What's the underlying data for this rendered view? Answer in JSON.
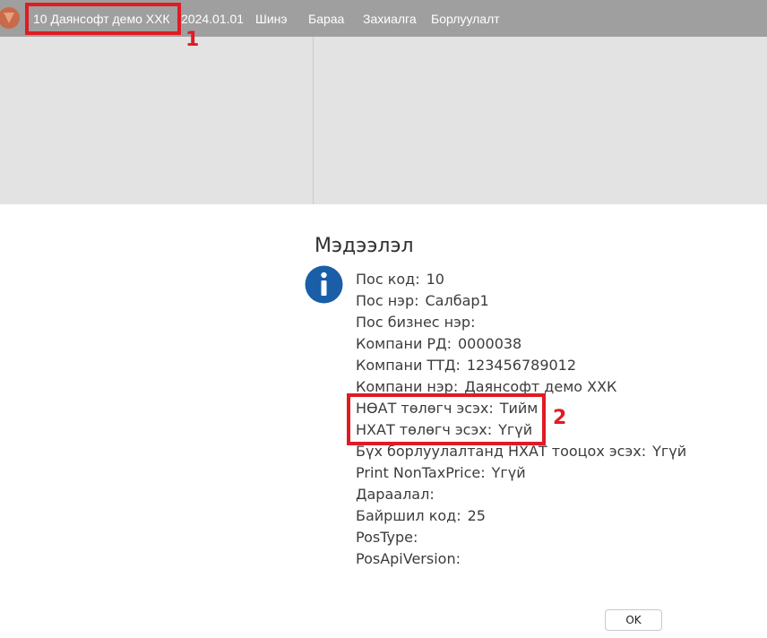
{
  "topbar": {
    "logo_icon": "app-logo-icon",
    "company": "10 Даянсофт демо ХХК",
    "date": "2024.01.01",
    "menu": [
      "Шинэ",
      "Бараа",
      "Захиалга",
      "Борлуулалт"
    ]
  },
  "annotations": {
    "marker_1": "1",
    "marker_2": "2",
    "color": "#e01b24"
  },
  "dialog": {
    "title": "Мэдээлэл",
    "icon": "info-icon",
    "rows": [
      {
        "label": "Пос код:",
        "value": "10"
      },
      {
        "label": "Пос нэр:",
        "value": "Салбар1"
      },
      {
        "label": "Пос бизнес нэр:",
        "value": ""
      },
      {
        "label": "Компани РД:",
        "value": "0000038"
      },
      {
        "label": "Компани ТТД:",
        "value": "123456789012"
      },
      {
        "label": "Компани нэр:",
        "value": "Даянсофт демо ХХК"
      },
      {
        "label": "НӨАТ төлөгч эсэх:",
        "value": "Тийм"
      },
      {
        "label": "НХАТ төлөгч эсэх:",
        "value": "Үгүй"
      },
      {
        "label": "Бүх борлуулалтанд НХАТ тооцох эсэх:",
        "value": "Үгүй"
      },
      {
        "label": "Print NonTaxPrice:",
        "value": "Үгүй"
      },
      {
        "label": "Дараалал:",
        "value": ""
      },
      {
        "label": "Байршил код:",
        "value": "25"
      },
      {
        "label": "PosType:",
        "value": ""
      },
      {
        "label": "PosApiVersion:",
        "value": ""
      }
    ],
    "ok_label": "OK"
  }
}
